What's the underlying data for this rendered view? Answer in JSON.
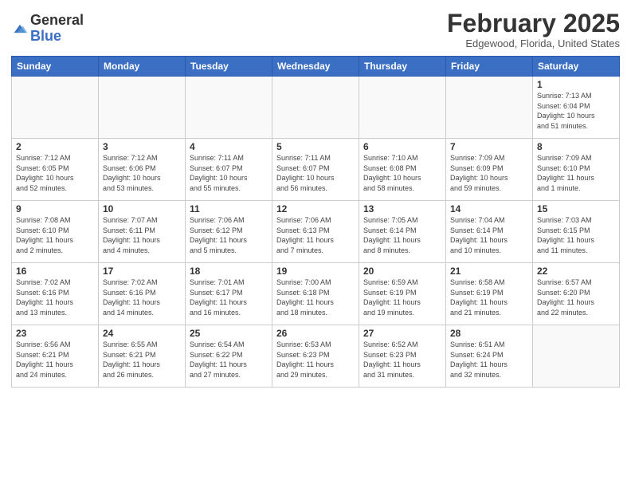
{
  "header": {
    "logo_general": "General",
    "logo_blue": "Blue",
    "month_title": "February 2025",
    "location": "Edgewood, Florida, United States"
  },
  "weekdays": [
    "Sunday",
    "Monday",
    "Tuesday",
    "Wednesday",
    "Thursday",
    "Friday",
    "Saturday"
  ],
  "weeks": [
    [
      {
        "day": "",
        "info": ""
      },
      {
        "day": "",
        "info": ""
      },
      {
        "day": "",
        "info": ""
      },
      {
        "day": "",
        "info": ""
      },
      {
        "day": "",
        "info": ""
      },
      {
        "day": "",
        "info": ""
      },
      {
        "day": "1",
        "info": "Sunrise: 7:13 AM\nSunset: 6:04 PM\nDaylight: 10 hours\nand 51 minutes."
      }
    ],
    [
      {
        "day": "2",
        "info": "Sunrise: 7:12 AM\nSunset: 6:05 PM\nDaylight: 10 hours\nand 52 minutes."
      },
      {
        "day": "3",
        "info": "Sunrise: 7:12 AM\nSunset: 6:06 PM\nDaylight: 10 hours\nand 53 minutes."
      },
      {
        "day": "4",
        "info": "Sunrise: 7:11 AM\nSunset: 6:07 PM\nDaylight: 10 hours\nand 55 minutes."
      },
      {
        "day": "5",
        "info": "Sunrise: 7:11 AM\nSunset: 6:07 PM\nDaylight: 10 hours\nand 56 minutes."
      },
      {
        "day": "6",
        "info": "Sunrise: 7:10 AM\nSunset: 6:08 PM\nDaylight: 10 hours\nand 58 minutes."
      },
      {
        "day": "7",
        "info": "Sunrise: 7:09 AM\nSunset: 6:09 PM\nDaylight: 10 hours\nand 59 minutes."
      },
      {
        "day": "8",
        "info": "Sunrise: 7:09 AM\nSunset: 6:10 PM\nDaylight: 11 hours\nand 1 minute."
      }
    ],
    [
      {
        "day": "9",
        "info": "Sunrise: 7:08 AM\nSunset: 6:10 PM\nDaylight: 11 hours\nand 2 minutes."
      },
      {
        "day": "10",
        "info": "Sunrise: 7:07 AM\nSunset: 6:11 PM\nDaylight: 11 hours\nand 4 minutes."
      },
      {
        "day": "11",
        "info": "Sunrise: 7:06 AM\nSunset: 6:12 PM\nDaylight: 11 hours\nand 5 minutes."
      },
      {
        "day": "12",
        "info": "Sunrise: 7:06 AM\nSunset: 6:13 PM\nDaylight: 11 hours\nand 7 minutes."
      },
      {
        "day": "13",
        "info": "Sunrise: 7:05 AM\nSunset: 6:14 PM\nDaylight: 11 hours\nand 8 minutes."
      },
      {
        "day": "14",
        "info": "Sunrise: 7:04 AM\nSunset: 6:14 PM\nDaylight: 11 hours\nand 10 minutes."
      },
      {
        "day": "15",
        "info": "Sunrise: 7:03 AM\nSunset: 6:15 PM\nDaylight: 11 hours\nand 11 minutes."
      }
    ],
    [
      {
        "day": "16",
        "info": "Sunrise: 7:02 AM\nSunset: 6:16 PM\nDaylight: 11 hours\nand 13 minutes."
      },
      {
        "day": "17",
        "info": "Sunrise: 7:02 AM\nSunset: 6:16 PM\nDaylight: 11 hours\nand 14 minutes."
      },
      {
        "day": "18",
        "info": "Sunrise: 7:01 AM\nSunset: 6:17 PM\nDaylight: 11 hours\nand 16 minutes."
      },
      {
        "day": "19",
        "info": "Sunrise: 7:00 AM\nSunset: 6:18 PM\nDaylight: 11 hours\nand 18 minutes."
      },
      {
        "day": "20",
        "info": "Sunrise: 6:59 AM\nSunset: 6:19 PM\nDaylight: 11 hours\nand 19 minutes."
      },
      {
        "day": "21",
        "info": "Sunrise: 6:58 AM\nSunset: 6:19 PM\nDaylight: 11 hours\nand 21 minutes."
      },
      {
        "day": "22",
        "info": "Sunrise: 6:57 AM\nSunset: 6:20 PM\nDaylight: 11 hours\nand 22 minutes."
      }
    ],
    [
      {
        "day": "23",
        "info": "Sunrise: 6:56 AM\nSunset: 6:21 PM\nDaylight: 11 hours\nand 24 minutes."
      },
      {
        "day": "24",
        "info": "Sunrise: 6:55 AM\nSunset: 6:21 PM\nDaylight: 11 hours\nand 26 minutes."
      },
      {
        "day": "25",
        "info": "Sunrise: 6:54 AM\nSunset: 6:22 PM\nDaylight: 11 hours\nand 27 minutes."
      },
      {
        "day": "26",
        "info": "Sunrise: 6:53 AM\nSunset: 6:23 PM\nDaylight: 11 hours\nand 29 minutes."
      },
      {
        "day": "27",
        "info": "Sunrise: 6:52 AM\nSunset: 6:23 PM\nDaylight: 11 hours\nand 31 minutes."
      },
      {
        "day": "28",
        "info": "Sunrise: 6:51 AM\nSunset: 6:24 PM\nDaylight: 11 hours\nand 32 minutes."
      },
      {
        "day": "",
        "info": ""
      }
    ]
  ]
}
